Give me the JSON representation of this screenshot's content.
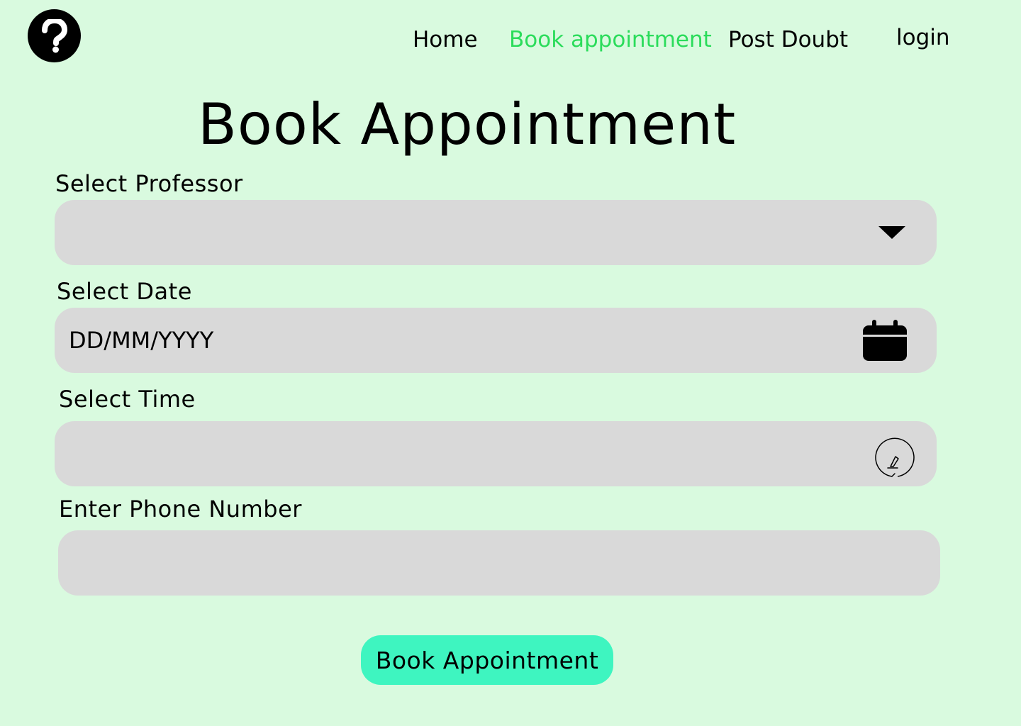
{
  "nav": {
    "home": "Home",
    "book": "Book appointment",
    "post": "Post Doubt",
    "login": "login",
    "active_color": "#2bdc5b"
  },
  "logo": {
    "icon": "question-mark-icon"
  },
  "page": {
    "title": "Book Appointment"
  },
  "form": {
    "professor": {
      "label": "Select Professor",
      "value": "",
      "icon": "chevron-down-icon"
    },
    "date": {
      "label": "Select Date",
      "placeholder": "DD/MM/YYYY",
      "value": "",
      "icon": "calendar-icon"
    },
    "time": {
      "label": "Select Time",
      "value": "",
      "icon": "clock-icon"
    },
    "phone": {
      "label": "Enter Phone Number",
      "value": ""
    },
    "submit_label": "Book Appointment"
  },
  "colors": {
    "background": "#d9fadf",
    "field": "#d9d9d9",
    "button": "#3ef5c0"
  }
}
